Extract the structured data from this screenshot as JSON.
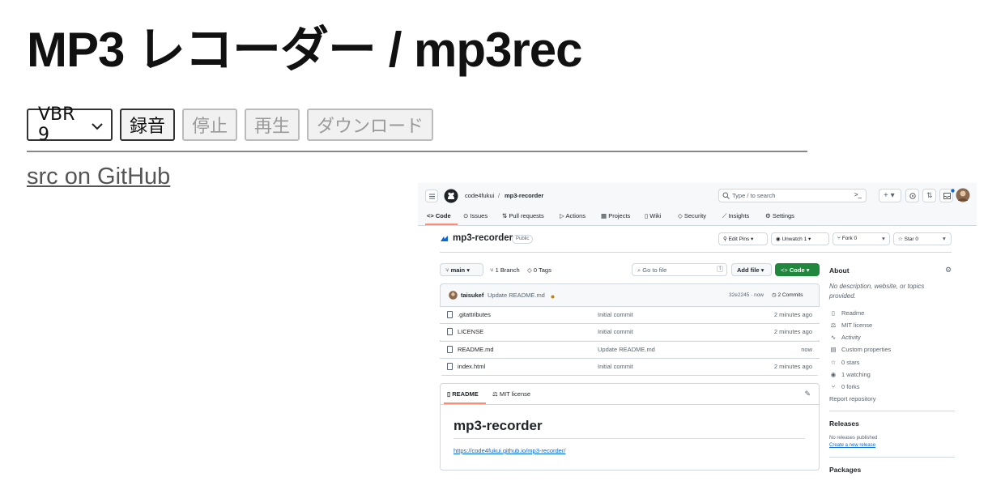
{
  "page": {
    "title": "MP3 レコーダー / mp3rec",
    "select_value": "VBR 9",
    "buttons": {
      "record": "録音",
      "stop": "停止",
      "play": "再生",
      "download": "ダウンロード"
    },
    "link": "src on GitHub"
  },
  "github": {
    "owner": "code4fukui",
    "separator": "/",
    "repo": "mp3-recorder",
    "search_placeholder": "Type / to search",
    "tabs": [
      "Code",
      "Issues",
      "Pull requests",
      "Actions",
      "Projects",
      "Wiki",
      "Security",
      "Insights",
      "Settings"
    ],
    "repo_title": "mp3-recorder",
    "visibility": "Public",
    "actions": {
      "edit_pins": "Edit Pins",
      "unwatch": "Unwatch",
      "unwatch_count": "1",
      "fork": "Fork",
      "fork_count": "0",
      "star": "Star",
      "star_count": "0"
    },
    "branch": "main",
    "branches": "1 Branch",
    "tags": "0 Tags",
    "go_to_file": "Go to file",
    "go_to_file_key": "t",
    "add_file": "Add file",
    "code_button": "Code",
    "commit": {
      "author": "taisukef",
      "message": "Update README.md",
      "hash_time": "32e2245 · now",
      "commits": "2 Commits"
    },
    "files": [
      {
        "name": ".gitattributes",
        "message": "Initial commit",
        "time": "2 minutes ago"
      },
      {
        "name": "LICENSE",
        "message": "Initial commit",
        "time": "2 minutes ago"
      },
      {
        "name": "README.md",
        "message": "Update README.md",
        "time": "now"
      },
      {
        "name": "index.html",
        "message": "Initial commit",
        "time": "2 minutes ago"
      }
    ],
    "readme_tabs": [
      "README",
      "MIT license"
    ],
    "readme_title": "mp3-recorder",
    "readme_link": "https://code4fukui.github.io/mp3-recorder/",
    "about": {
      "heading": "About",
      "description": "No description, website, or topics provided.",
      "items": [
        "Readme",
        "MIT license",
        "Activity",
        "Custom properties",
        "0 stars",
        "1 watching",
        "0 forks",
        "Report repository"
      ]
    },
    "releases": {
      "heading": "Releases",
      "none": "No releases published",
      "create": "Create a new release"
    },
    "packages_heading": "Packages"
  }
}
